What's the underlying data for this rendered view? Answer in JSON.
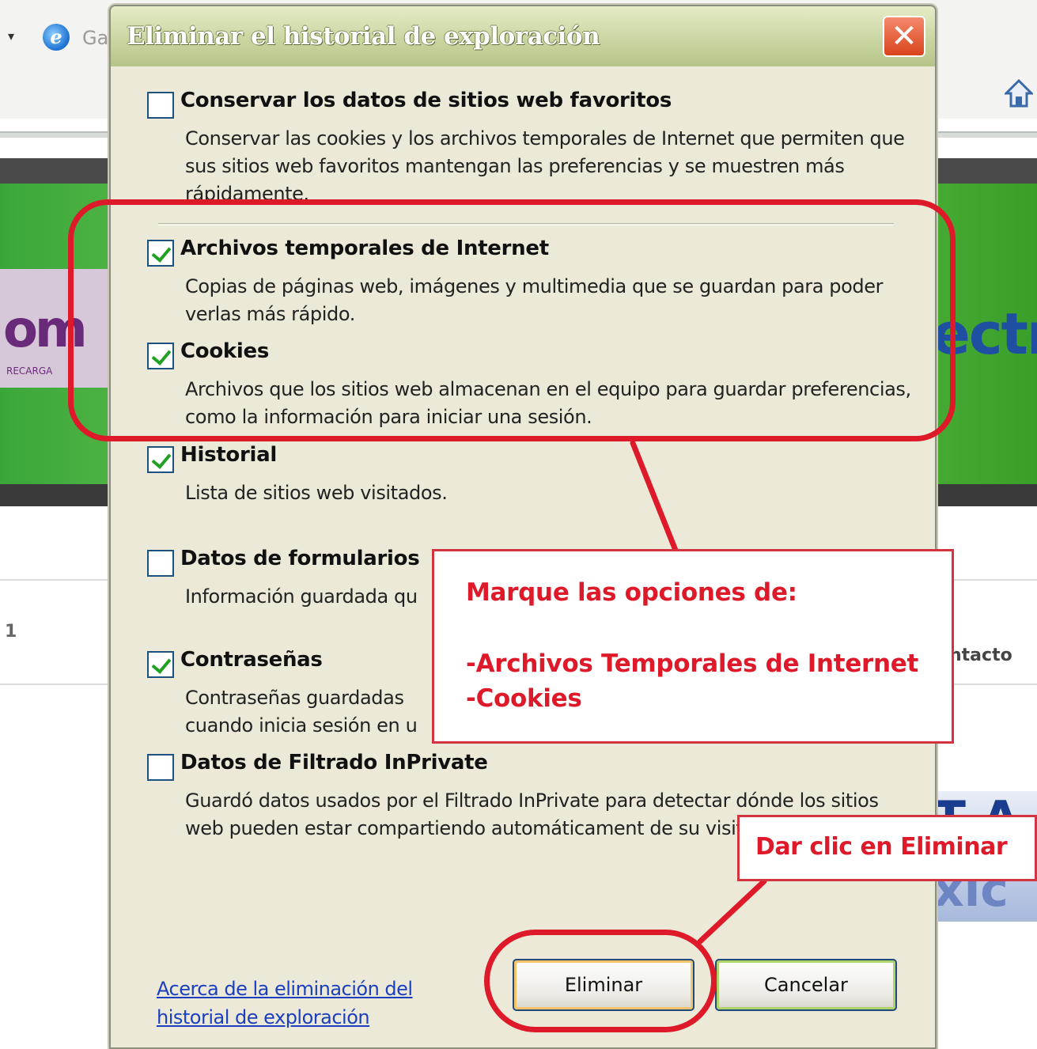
{
  "browser": {
    "tab_text": "Ga",
    "side_right_text": "ntacto",
    "side_left_text": "1",
    "logo_text": "om",
    "logo_sub": "RECARGA",
    "brand_text": "ectr",
    "banner_top": "T A",
    "banner_bottom": "xic"
  },
  "dialog": {
    "title": "Eliminar el historial de exploración",
    "close_label": "✕",
    "options": [
      {
        "title": "Conservar los datos de sitios web favoritos",
        "desc": "Conservar las cookies y los archivos temporales de Internet que permiten que sus sitios web favoritos mantengan las preferencias y se muestren más rápidamente.",
        "checked": false
      },
      {
        "title": "Archivos temporales de Internet",
        "desc": "Copias de páginas web, imágenes y multimedia que se guardan para poder verlas más rápido.",
        "checked": true
      },
      {
        "title": "Cookies",
        "desc": "Archivos que los sitios web almacenan en el equipo para guardar preferencias, como la información para iniciar una sesión.",
        "checked": true
      },
      {
        "title": "Historial",
        "desc": "Lista de sitios web visitados.",
        "checked": true
      },
      {
        "title": "Datos de formularios",
        "desc": "Información guardada qu",
        "checked": false
      },
      {
        "title": "Contraseñas",
        "desc": "Contraseñas guardadas cuando inicia sesión en u",
        "checked": true
      },
      {
        "title": "Datos de Filtrado InPrivate",
        "desc": "Guardó datos usados por el Filtrado InPrivate para detectar dónde los sitios web pueden estar compartiendo automáticament de su visita.",
        "checked": false
      }
    ],
    "about_link": "Acerca de la eliminación del historial de exploración",
    "delete_button": "Eliminar",
    "cancel_button": "Cancelar"
  },
  "annotations": {
    "main_line1": "Marque las opciones de:",
    "main_line2": "-Archivos Temporales de Internet",
    "main_line3": "-Cookies",
    "small_text": "Dar clic en Eliminar",
    "color": "#de1a2a"
  }
}
